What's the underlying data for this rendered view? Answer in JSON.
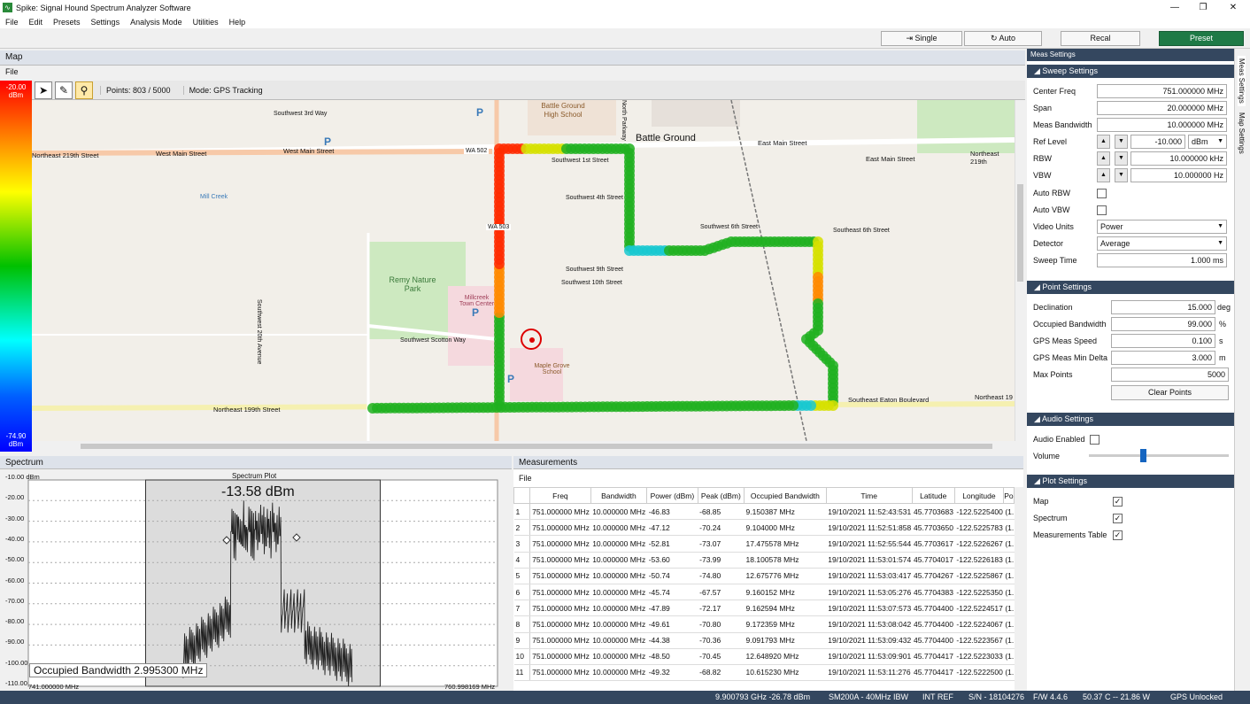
{
  "window": {
    "title": "Spike: Signal Hound Spectrum Analyzer Software",
    "minimize": "—",
    "maximize": "❐",
    "close": "✕"
  },
  "menu": [
    "File",
    "Edit",
    "Presets",
    "Settings",
    "Analysis Mode",
    "Utilities",
    "Help"
  ],
  "toolbar": {
    "single": "Single",
    "auto": "Auto",
    "recal": "Recal",
    "preset": "Preset"
  },
  "map_panel": {
    "title": "Map",
    "file": "File",
    "points": "Points: 803 / 5000",
    "mode": "Mode: GPS Tracking",
    "legend_top": "-20.00",
    "legend_top_unit": "dBm",
    "legend_bottom": "-74.90",
    "legend_bottom_unit": "dBm",
    "labels": [
      "Battle Ground",
      "Battle Ground High School",
      "West Main Street",
      "West Main Street",
      "Northeast 219th Street",
      "East Main Street",
      "East Main Street",
      "WA 502",
      "WA 503",
      "Southwest 1st Street",
      "Southwest 4th Street",
      "Southwest 6th Street",
      "Southwest 9th Street",
      "Southwest 10th Street",
      "Southwest 3rd Way",
      "Mill Creek",
      "Remy Nature Park",
      "Millcreek Town Center",
      "Maple Grove School",
      "Southwest Scotton Way",
      "Northeast 199th Street",
      "Southeast Eaton Boulevard",
      "Northeast 19",
      "Northeast 219th",
      "Southwest 20th Avenue",
      "North Parkway",
      "Southeast 6th Street"
    ]
  },
  "spectrum": {
    "title": "Spectrum",
    "plot_title": "Spectrum Plot",
    "marker": "-13.58 dBm",
    "occupied_bw": "Occupied Bandwidth 2.995300 MHz",
    "start_freq": "741.000000 MHz",
    "stop_freq": "760.998169 MHz",
    "y_ticks": [
      "-10.00 dBm",
      "-20.00",
      "-30.00",
      "-40.00",
      "-50.00",
      "-60.00",
      "-70.00",
      "-80.00",
      "-90.00",
      "-100.00",
      "-110.00"
    ]
  },
  "measurements": {
    "title": "Measurements",
    "file": "File",
    "headers": [
      "Freq",
      "Bandwidth",
      "Power (dBm)",
      "Peak (dBm)",
      "Occupied Bandwidth",
      "Time",
      "Latitude",
      "Longitude",
      "Po"
    ],
    "rows": [
      [
        "1",
        "751.000000 MHz",
        "10.000000 MHz",
        "-46.83",
        "-68.85",
        "9.150387 MHz",
        "19/10/2021 11:52:43:531",
        "45.7703683",
        "-122.5225400",
        "(1."
      ],
      [
        "2",
        "751.000000 MHz",
        "10.000000 MHz",
        "-47.12",
        "-70.24",
        "9.104000 MHz",
        "19/10/2021 11:52:51:858",
        "45.7703650",
        "-122.5225783",
        "(1."
      ],
      [
        "3",
        "751.000000 MHz",
        "10.000000 MHz",
        "-52.81",
        "-73.07",
        "17.475578 MHz",
        "19/10/2021 11:52:55:544",
        "45.7703617",
        "-122.5226267",
        "(1."
      ],
      [
        "4",
        "751.000000 MHz",
        "10.000000 MHz",
        "-53.60",
        "-73.99",
        "18.100578 MHz",
        "19/10/2021 11:53:01:574",
        "45.7704017",
        "-122.5226183",
        "(1."
      ],
      [
        "5",
        "751.000000 MHz",
        "10.000000 MHz",
        "-50.74",
        "-74.80",
        "12.675776 MHz",
        "19/10/2021 11:53:03:417",
        "45.7704267",
        "-122.5225867",
        "(1."
      ],
      [
        "6",
        "751.000000 MHz",
        "10.000000 MHz",
        "-45.74",
        "-67.57",
        "9.160152 MHz",
        "19/10/2021 11:53:05:276",
        "45.7704383",
        "-122.5225350",
        "(1."
      ],
      [
        "7",
        "751.000000 MHz",
        "10.000000 MHz",
        "-47.89",
        "-72.17",
        "9.162594 MHz",
        "19/10/2021 11:53:07:573",
        "45.7704400",
        "-122.5224517",
        "(1."
      ],
      [
        "8",
        "751.000000 MHz",
        "10.000000 MHz",
        "-49.61",
        "-70.80",
        "9.172359 MHz",
        "19/10/2021 11:53:08:042",
        "45.7704400",
        "-122.5224067",
        "(1."
      ],
      [
        "9",
        "751.000000 MHz",
        "10.000000 MHz",
        "-44.38",
        "-70.36",
        "9.091793 MHz",
        "19/10/2021 11:53:09:432",
        "45.7704400",
        "-122.5223567",
        "(1."
      ],
      [
        "10",
        "751.000000 MHz",
        "10.000000 MHz",
        "-48.50",
        "-70.45",
        "12.648920 MHz",
        "19/10/2021 11:53:09:901",
        "45.7704417",
        "-122.5223033",
        "(1."
      ],
      [
        "11",
        "751.000000 MHz",
        "10.000000 MHz",
        "-49.32",
        "-68.82",
        "10.615230 MHz",
        "19/10/2021 11:53:11:276",
        "45.7704417",
        "-122.5222500",
        "(1."
      ]
    ]
  },
  "settings": {
    "header": "Meas Settings",
    "sweep": {
      "title": "Sweep Settings",
      "center_label": "Center Freq",
      "center": "751.000000 MHz",
      "span_label": "Span",
      "span": "20.000000 MHz",
      "measbw_label": "Meas Bandwidth",
      "measbw": "10.000000 MHz",
      "ref_label": "Ref Level",
      "ref": "-10.000",
      "ref_unit": "dBm",
      "rbw_label": "RBW",
      "rbw": "10.000000 kHz",
      "vbw_label": "VBW",
      "vbw": "10.000000 Hz",
      "autorbw_label": "Auto RBW",
      "autovbw_label": "Auto VBW",
      "video_label": "Video Units",
      "video": "Power",
      "det_label": "Detector",
      "det": "Average",
      "sweeptime_label": "Sweep Time",
      "sweeptime": "1.000 ms"
    },
    "point": {
      "title": "Point Settings",
      "decl_label": "Declination",
      "decl": "15.000",
      "decl_unit": "deg",
      "obw_label": "Occupied Bandwidth",
      "obw": "99.000",
      "obw_unit": "%",
      "gpsspeed_label": "GPS Meas Speed",
      "gpsspeed": "0.100",
      "gpsspeed_unit": "s",
      "gpsdelta_label": "GPS Meas Min Delta",
      "gpsdelta": "3.000",
      "gpsdelta_unit": "m",
      "maxpts_label": "Max Points",
      "maxpts": "5000",
      "clear": "Clear Points"
    },
    "audio": {
      "title": "Audio Settings",
      "enabled_label": "Audio Enabled",
      "volume_label": "Volume"
    },
    "plot": {
      "title": "Plot Settings",
      "map_label": "Map",
      "spectrum_label": "Spectrum",
      "table_label": "Measurements Table"
    }
  },
  "side_tabs": [
    "Meas Settings",
    "Map Settings"
  ],
  "status": {
    "marker": "9.900793 GHz  -26.78 dBm",
    "device": "SM200A - 40MHz IBW",
    "ref": "INT REF",
    "serial": "S/N - 18104276",
    "fw": "F/W 4.4.6",
    "temp": "50.37 C -- 21.86 W",
    "gps": "GPS Unlocked"
  }
}
